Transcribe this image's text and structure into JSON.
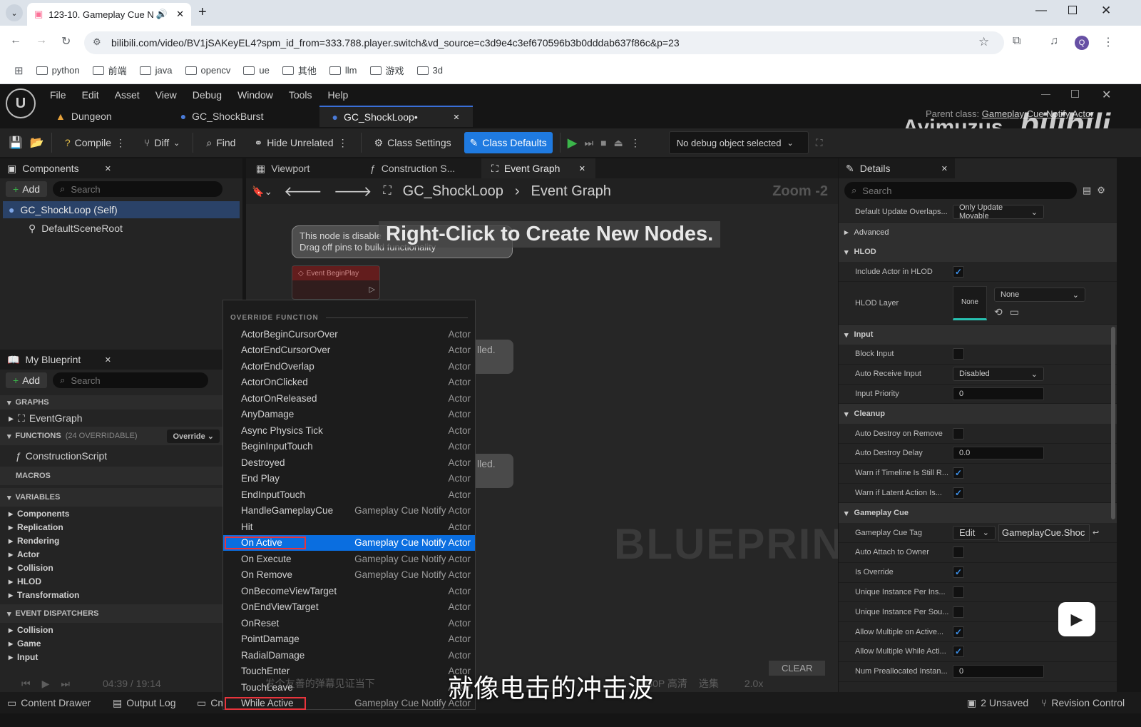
{
  "browser": {
    "tab_title": "123-10. Gameplay Cue N",
    "url": "bilibili.com/video/BV1jSAKeyEL4?spm_id_from=333.788.player.switch&vd_source=c3d9e4c3ef670596b3b0dddab637f86c&p=23",
    "bookmarks": [
      "python",
      "前端",
      "java",
      "opencv",
      "ue",
      "其他",
      "llm",
      "游戏",
      "3d"
    ],
    "profile_initial": "Q"
  },
  "editor": {
    "menu": [
      "File",
      "Edit",
      "Asset",
      "View",
      "Debug",
      "Window",
      "Tools",
      "Help"
    ],
    "doc_tabs": [
      "Dungeon",
      "GC_ShockBurst",
      "GC_ShockLoop•"
    ],
    "parent_class_label": "Parent class:",
    "parent_class_value": "Gameplay Cue Notify Actor",
    "watermark": "Ayimuzus",
    "toolbar": {
      "compile": "Compile",
      "diff": "Diff",
      "find": "Find",
      "hide_unrelated": "Hide Unrelated",
      "class_settings": "Class Settings",
      "class_defaults": "Class Defaults",
      "debug_object": "No debug object selected"
    }
  },
  "components": {
    "title": "Components",
    "add": "Add",
    "search_placeholder": "Search",
    "items": [
      "GC_ShockLoop (Self)",
      "DefaultSceneRoot"
    ]
  },
  "my_blueprint": {
    "title": "My Blueprint",
    "add": "Add",
    "search_placeholder": "Search",
    "graphs_header": "GRAPHS",
    "event_graph": "EventGraph",
    "functions_header": "FUNCTIONS",
    "functions_count": "(24 OVERRIDABLE)",
    "override": "Override",
    "construction_script": "ConstructionScript",
    "macros_header": "MACROS",
    "variables_header": "VARIABLES",
    "variables": [
      "Components",
      "Replication",
      "Rendering",
      "Actor",
      "Collision",
      "HLOD",
      "Transformation"
    ],
    "dispatchers_header": "EVENT DISPATCHERS",
    "dispatchers": [
      "Collision",
      "Game",
      "Input"
    ]
  },
  "graph": {
    "tabs": [
      "Viewport",
      "Construction S...",
      "Event Graph"
    ],
    "breadcrumb_root": "GC_ShockLoop",
    "breadcrumb_leaf": "Event Graph",
    "zoom": "Zoom -2",
    "hint": "Right-Click to Create New Nodes.",
    "disabled_note_1": "This node is disable",
    "disabled_note_2": "Drag off pins to build functionality",
    "begin_play": "Event BeginPlay",
    "node_fragment": "lled.",
    "watermark": "BLUEPRINT"
  },
  "context_menu": {
    "header": "OVERRIDE FUNCTION",
    "items": [
      {
        "name": "ActorBeginCursorOver",
        "category": "Actor"
      },
      {
        "name": "ActorEndCursorOver",
        "category": "Actor"
      },
      {
        "name": "ActorEndOverlap",
        "category": "Actor"
      },
      {
        "name": "ActorOnClicked",
        "category": "Actor"
      },
      {
        "name": "ActorOnReleased",
        "category": "Actor"
      },
      {
        "name": "AnyDamage",
        "category": "Actor"
      },
      {
        "name": "Async Physics Tick",
        "category": "Actor"
      },
      {
        "name": "BeginInputTouch",
        "category": "Actor"
      },
      {
        "name": "Destroyed",
        "category": "Actor"
      },
      {
        "name": "End Play",
        "category": "Actor"
      },
      {
        "name": "EndInputTouch",
        "category": "Actor"
      },
      {
        "name": "HandleGameplayCue",
        "category": "Gameplay Cue Notify Actor"
      },
      {
        "name": "Hit",
        "category": "Actor"
      },
      {
        "name": "On Active",
        "category": "Gameplay Cue Notify Actor"
      },
      {
        "name": "On Execute",
        "category": "Gameplay Cue Notify Actor"
      },
      {
        "name": "On Remove",
        "category": "Gameplay Cue Notify Actor"
      },
      {
        "name": "OnBecomeViewTarget",
        "category": "Actor"
      },
      {
        "name": "OnEndViewTarget",
        "category": "Actor"
      },
      {
        "name": "OnReset",
        "category": "Actor"
      },
      {
        "name": "PointDamage",
        "category": "Actor"
      },
      {
        "name": "RadialDamage",
        "category": "Actor"
      },
      {
        "name": "TouchEnter",
        "category": "Actor"
      },
      {
        "name": "TouchLeave",
        "category": "Actor"
      },
      {
        "name": "While Active",
        "category": "Gameplay Cue Notify Actor"
      }
    ],
    "selected": "On Active"
  },
  "details": {
    "title": "Details",
    "search_placeholder": "Search",
    "rows": [
      {
        "type": "row",
        "label": "Default Update Overlaps...",
        "kind": "dropdown",
        "value": "Only Update Movable"
      },
      {
        "type": "section",
        "label": "Advanced",
        "collapsed": true
      },
      {
        "type": "section",
        "label": "HLOD"
      },
      {
        "type": "row",
        "label": "Include Actor in HLOD",
        "kind": "check",
        "checked": true
      },
      {
        "type": "hlod",
        "label": "HLOD Layer",
        "thumb": "None",
        "value": "None"
      },
      {
        "type": "section",
        "label": "Input"
      },
      {
        "type": "row",
        "label": "Block Input",
        "kind": "check",
        "checked": false
      },
      {
        "type": "row",
        "label": "Auto Receive Input",
        "kind": "dropdown",
        "value": "Disabled"
      },
      {
        "type": "row",
        "label": "Input Priority",
        "kind": "number",
        "value": "0"
      },
      {
        "type": "section",
        "label": "Cleanup"
      },
      {
        "type": "row",
        "label": "Auto Destroy on Remove",
        "kind": "check",
        "checked": false
      },
      {
        "type": "row",
        "label": "Auto Destroy Delay",
        "kind": "number",
        "value": "0.0"
      },
      {
        "type": "row",
        "label": "Warn if Timeline Is Still R...",
        "kind": "check",
        "checked": true
      },
      {
        "type": "row",
        "label": "Warn if Latent Action Is...",
        "kind": "check",
        "checked": true
      },
      {
        "type": "section",
        "label": "Gameplay Cue"
      },
      {
        "type": "tag",
        "label": "Gameplay Cue Tag",
        "edit": "Edit",
        "value": "GameplayCue.Shoc"
      },
      {
        "type": "row",
        "label": "Auto Attach to Owner",
        "kind": "check",
        "checked": false
      },
      {
        "type": "row",
        "label": "Is Override",
        "kind": "check",
        "checked": true
      },
      {
        "type": "row",
        "label": "Unique Instance Per Ins...",
        "kind": "check",
        "checked": false
      },
      {
        "type": "row",
        "label": "Unique Instance Per Sou...",
        "kind": "check",
        "checked": false
      },
      {
        "type": "row",
        "label": "Allow Multiple on Active...",
        "kind": "check",
        "checked": true
      },
      {
        "type": "row",
        "label": "Allow Multiple While Acti...",
        "kind": "check",
        "checked": true
      },
      {
        "type": "row",
        "label": "Num Preallocated Instan...",
        "kind": "number",
        "value": "0"
      }
    ]
  },
  "player": {
    "time": "04:39 / 19:14",
    "danmaku_placeholder": "发个友善的弹幕见证当下",
    "quality": "1080P 高清",
    "episodes": "选集",
    "speed": "2.0x",
    "subtitle": "就像电击的冲击波",
    "clear": "CLEAR"
  },
  "status": {
    "content_drawer": "Content Drawer",
    "output_log": "Output Log",
    "cmd": "Cm",
    "unsaved": "2 Unsaved",
    "revision": "Revision Control"
  }
}
